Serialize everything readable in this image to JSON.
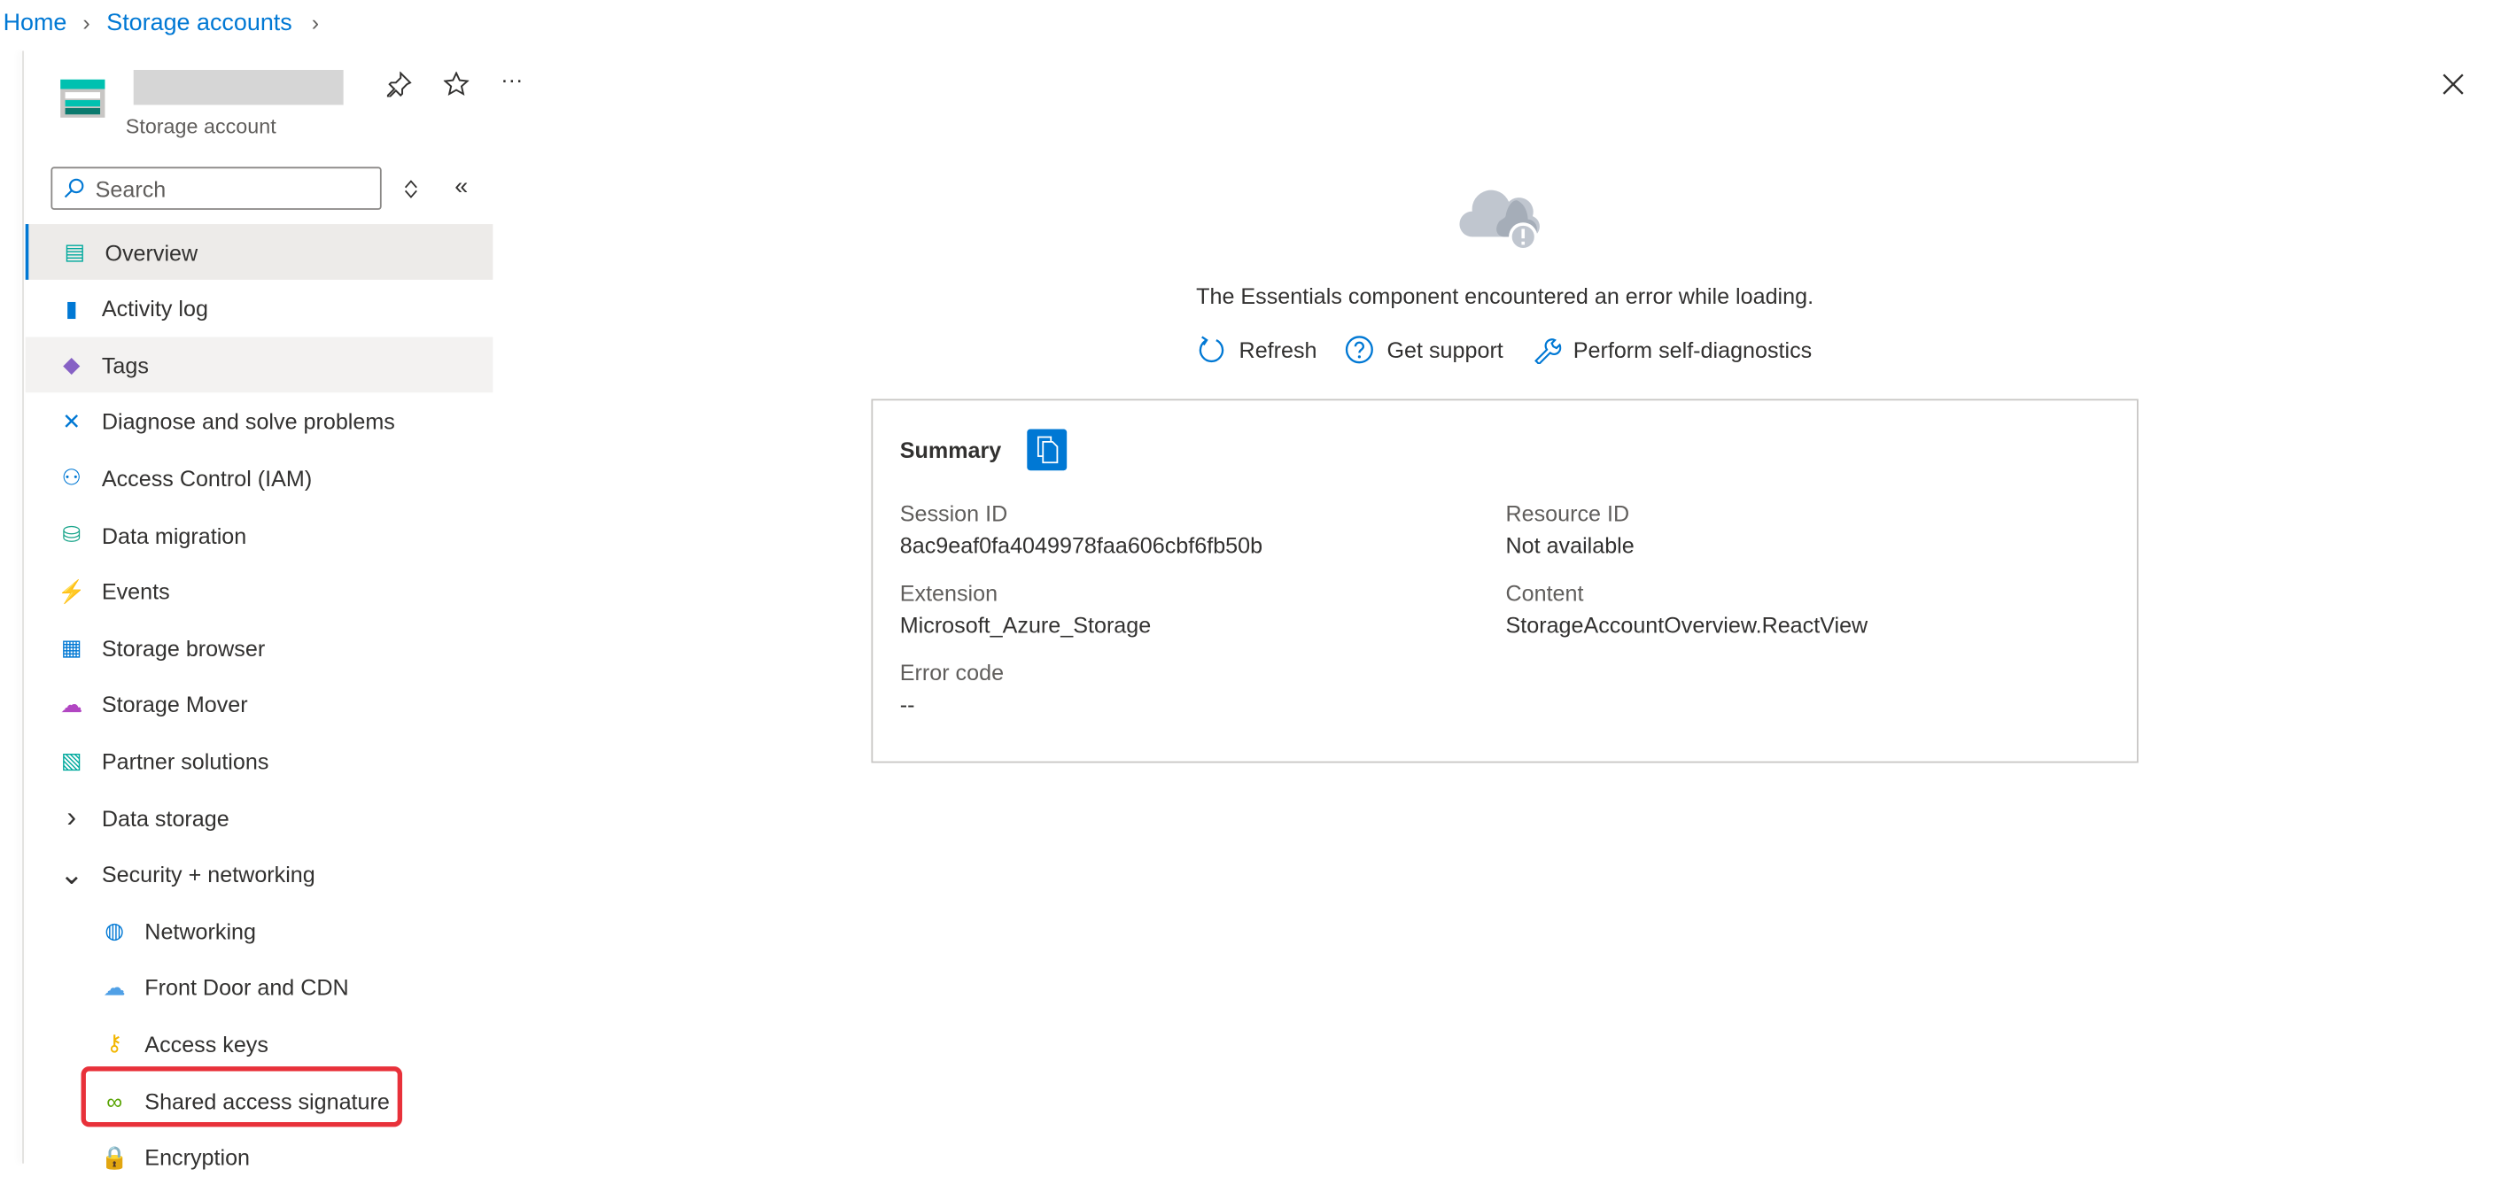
{
  "breadcrumb": [
    "Home",
    "Storage accounts"
  ],
  "resource": {
    "name_redacted": true,
    "type": "Storage account"
  },
  "header_actions": {
    "pin": "pin-icon",
    "favorite": "star-icon",
    "more": "···",
    "close": "close-icon"
  },
  "search": {
    "placeholder": "Search"
  },
  "nav": [
    {
      "label": "Overview",
      "icon": "storage-overview-icon",
      "selected": true
    },
    {
      "label": "Activity log",
      "icon": "activity-log-icon"
    },
    {
      "label": "Tags",
      "icon": "tag-icon",
      "hover": true
    },
    {
      "label": "Diagnose and solve problems",
      "icon": "wrench-icon"
    },
    {
      "label": "Access Control (IAM)",
      "icon": "people-icon"
    },
    {
      "label": "Data migration",
      "icon": "data-migration-icon"
    },
    {
      "label": "Events",
      "icon": "lightning-icon"
    },
    {
      "label": "Storage browser",
      "icon": "storage-browser-icon"
    },
    {
      "label": "Storage Mover",
      "icon": "storage-mover-icon"
    },
    {
      "label": "Partner solutions",
      "icon": "partner-icon"
    },
    {
      "label": "Data storage",
      "icon": "chevron-right-icon",
      "group": true
    },
    {
      "label": "Security + networking",
      "icon": "chevron-down-icon",
      "group": true
    },
    {
      "label": "Networking",
      "icon": "networking-icon",
      "sub": true
    },
    {
      "label": "Front Door and CDN",
      "icon": "cdn-icon",
      "sub": true
    },
    {
      "label": "Access keys",
      "icon": "key-icon",
      "sub": true
    },
    {
      "label": "Shared access signature",
      "icon": "link-icon",
      "sub": true,
      "highlighted": true
    },
    {
      "label": "Encryption",
      "icon": "lock-icon",
      "sub": true
    }
  ],
  "error": {
    "message": "The Essentials component encountered an error while loading.",
    "actions": [
      {
        "label": "Refresh",
        "icon": "refresh-icon"
      },
      {
        "label": "Get support",
        "icon": "help-icon"
      },
      {
        "label": "Perform self-diagnostics",
        "icon": "wrench-icon"
      }
    ]
  },
  "summary": {
    "title": "Summary",
    "fields": [
      {
        "label": "Session ID",
        "value": "8ac9eaf0fa4049978faa606cbf6fb50b"
      },
      {
        "label": "Resource ID",
        "value": "Not available"
      },
      {
        "label": "Extension",
        "value": "Microsoft_Azure_Storage"
      },
      {
        "label": "Content",
        "value": "StorageAccountOverview.ReactView"
      },
      {
        "label": "Error code",
        "value": "--"
      }
    ]
  },
  "colors": {
    "accent": "#0078d4",
    "highlight_box": "#e8313a",
    "selected_bg": "#edebe9"
  }
}
